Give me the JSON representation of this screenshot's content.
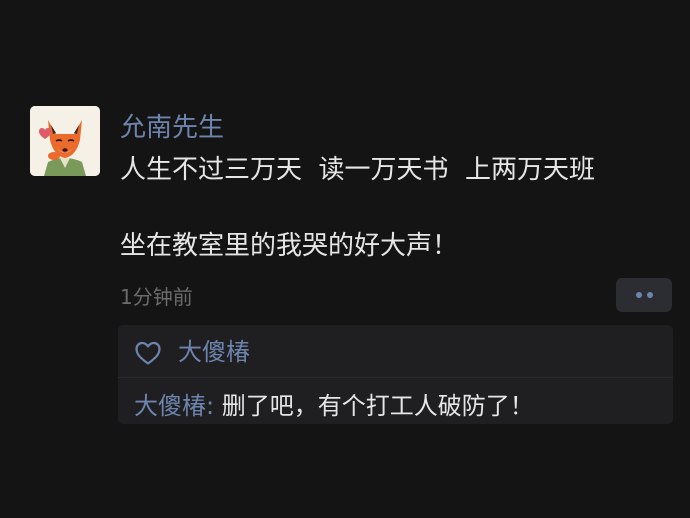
{
  "post": {
    "author": "允南先生",
    "lines": [
      "人生不过三万天  读一万天书  上两万天班",
      "坐在教室里的我哭的好大声！"
    ],
    "timestamp": "1分钟前"
  },
  "interactions": {
    "likes": {
      "icon": "heart-icon",
      "names": "大傻椿"
    },
    "comments": [
      {
        "author": "大傻椿",
        "separator": ": ",
        "text": "删了吧，有个打工人破防了！"
      }
    ]
  },
  "colors": {
    "background": "#141414",
    "link_blue": "#6d84ad",
    "text": "#e6e6e6",
    "muted": "#6b6b6b",
    "panel": "#1f1f21"
  }
}
